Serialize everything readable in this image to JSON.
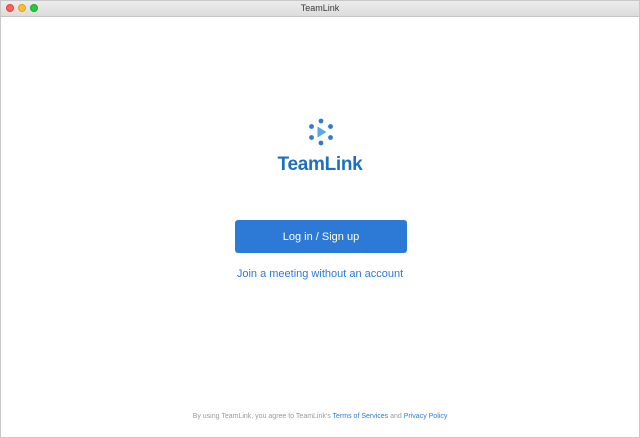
{
  "window": {
    "title": "TeamLink"
  },
  "brand": {
    "name": "TeamLink",
    "color": "#1f6fbf",
    "logo_icon": "teamlink-logo-icon"
  },
  "actions": {
    "login_label": "Log in / Sign up",
    "join_label": "Join a meeting without an account"
  },
  "footer": {
    "prefix": "By using TeamLink,  you agree to TeamLink's ",
    "terms_label": "Terms of Services",
    "conjunction": " and ",
    "privacy_label": "Privacy Policy"
  },
  "colors": {
    "accent": "#2c7ad6",
    "close": "#fe5f57",
    "minimize": "#febc2e",
    "zoom": "#28c840"
  }
}
